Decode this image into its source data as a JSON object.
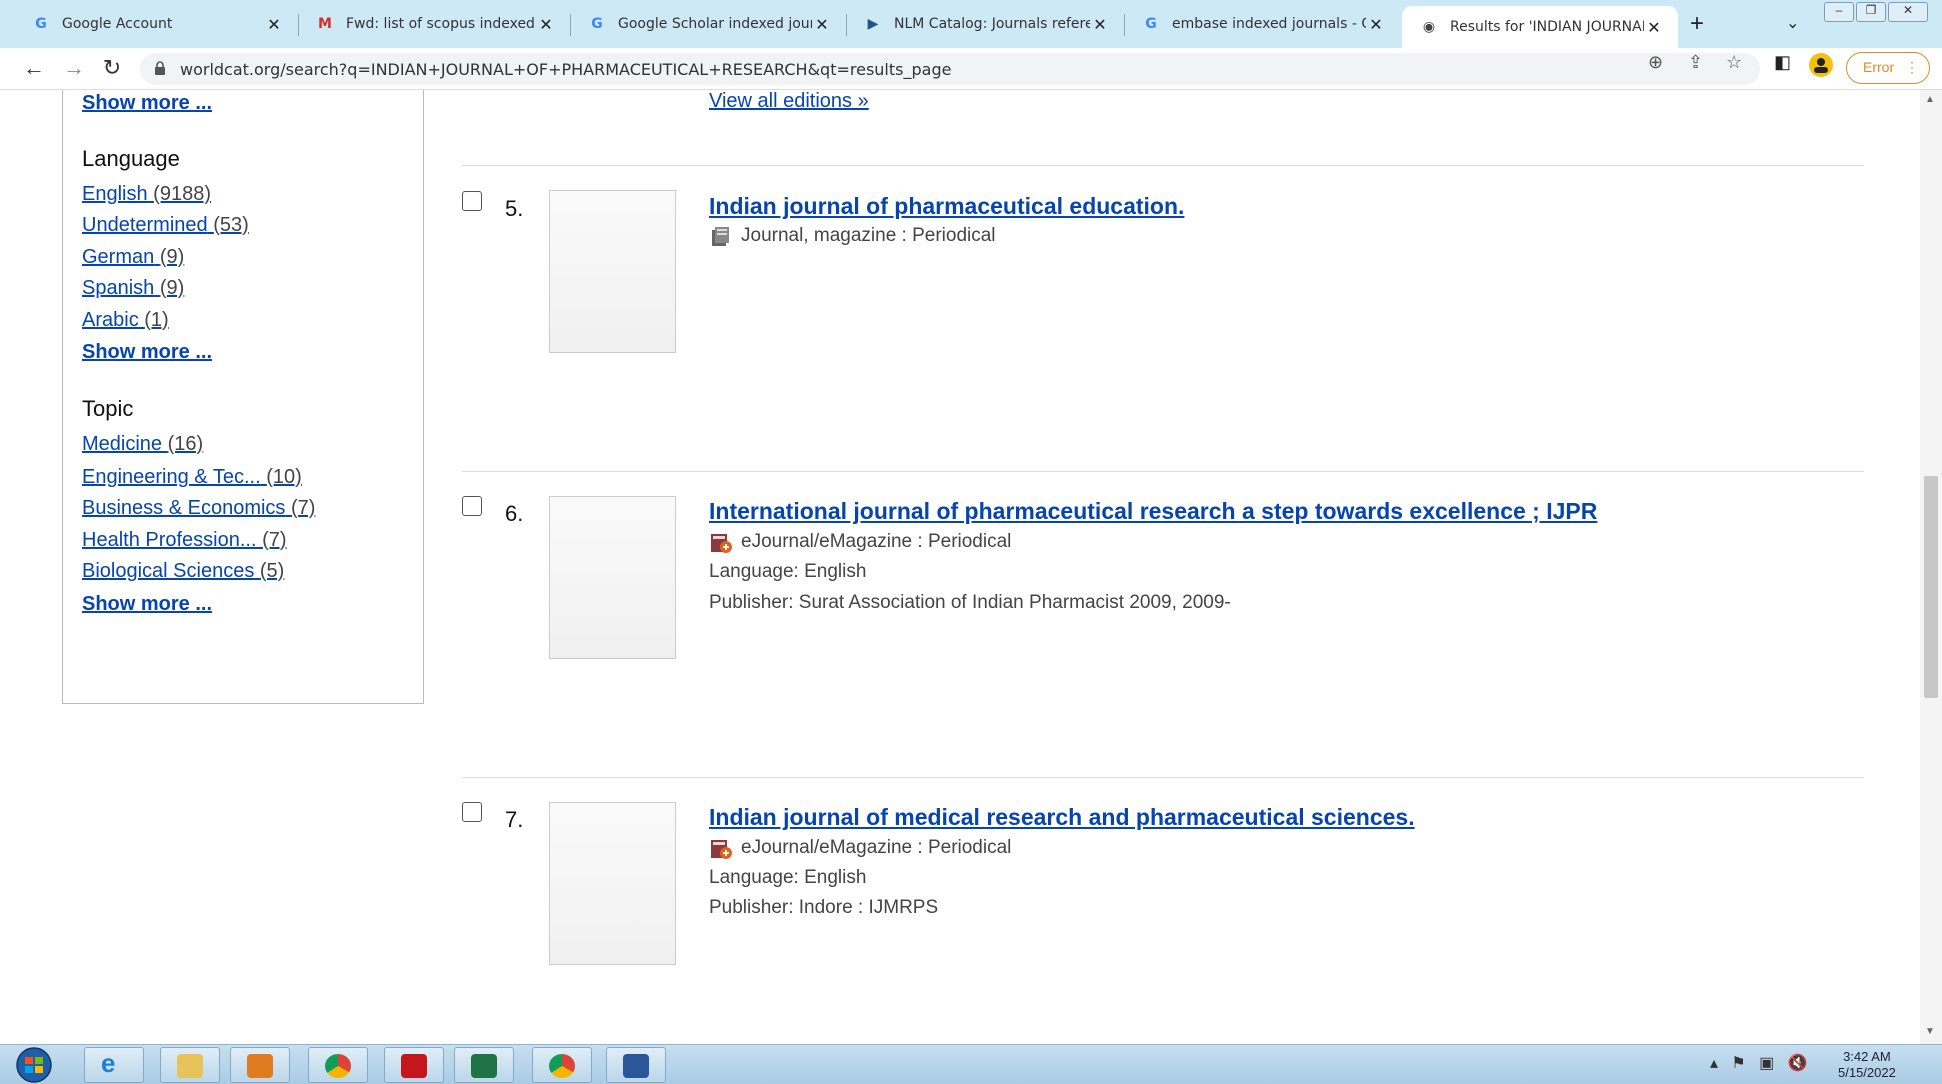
{
  "browser": {
    "tabs": [
      {
        "label": "Google Account",
        "favicon": "google-g-icon",
        "active": false
      },
      {
        "label": "Fwd: list of scopus indexed wo",
        "favicon": "gmail-icon",
        "active": false
      },
      {
        "label": "Google Scholar indexed journa",
        "favicon": "google-g-icon",
        "active": false
      },
      {
        "label": "NLM Catalog: Journals referenc",
        "favicon": "nlm-icon",
        "active": false
      },
      {
        "label": "embase indexed journals - Goo",
        "favicon": "google-g-icon",
        "active": false
      },
      {
        "label": "Results for 'INDIAN JOURNAL C",
        "favicon": "worldcat-globe-icon",
        "active": true
      }
    ],
    "url": "worldcat.org/search?q=INDIAN+JOURNAL+OF+PHARMACEUTICAL+RESEARCH&qt=results_page",
    "error_label": "Error"
  },
  "sidebar": {
    "top_show_more": "Show more ...",
    "language": {
      "heading": "Language",
      "items": [
        {
          "label": "English",
          "count": "(9188)"
        },
        {
          "label": "Undetermined",
          "count": "(53)"
        },
        {
          "label": "German",
          "count": "(9)"
        },
        {
          "label": "Spanish",
          "count": "(9)"
        },
        {
          "label": "Arabic",
          "count": "(1)"
        }
      ],
      "show_more": "Show more ..."
    },
    "topic": {
      "heading": "Topic",
      "items": [
        {
          "label": "Medicine",
          "count": "(16)"
        },
        {
          "label": "Engineering & Tec...",
          "count": "(10)"
        },
        {
          "label": "Business & Economics",
          "count": "(7)"
        },
        {
          "label": "Health Profession...",
          "count": "(7)"
        },
        {
          "label": "Biological Sciences",
          "count": "(5)"
        }
      ],
      "show_more": "Show more ..."
    }
  },
  "results": {
    "view_all_editions": "View all editions »",
    "items": [
      {
        "num": "5.",
        "title": "Indian journal of pharmaceutical education.",
        "format": "Journal, magazine : Periodical",
        "format_icon": "journal-icon",
        "language": "",
        "publisher": ""
      },
      {
        "num": "6.",
        "title": "International journal of pharmaceutical research a step towards excellence ; IJPR",
        "format": "eJournal/eMagazine : Periodical",
        "format_icon": "ejournal-icon",
        "language": "Language: English",
        "publisher": "Publisher: Surat Association of Indian Pharmacist 2009, 2009-"
      },
      {
        "num": "7.",
        "title": "Indian journal of medical research and pharmaceutical sciences.",
        "format": "eJournal/eMagazine : Periodical",
        "format_icon": "ejournal-icon",
        "language": "Language: English",
        "publisher": "Publisher: Indore : IJMRPS"
      }
    ]
  },
  "taskbar": {
    "time": "3:42 AM",
    "date": "5/15/2022"
  }
}
